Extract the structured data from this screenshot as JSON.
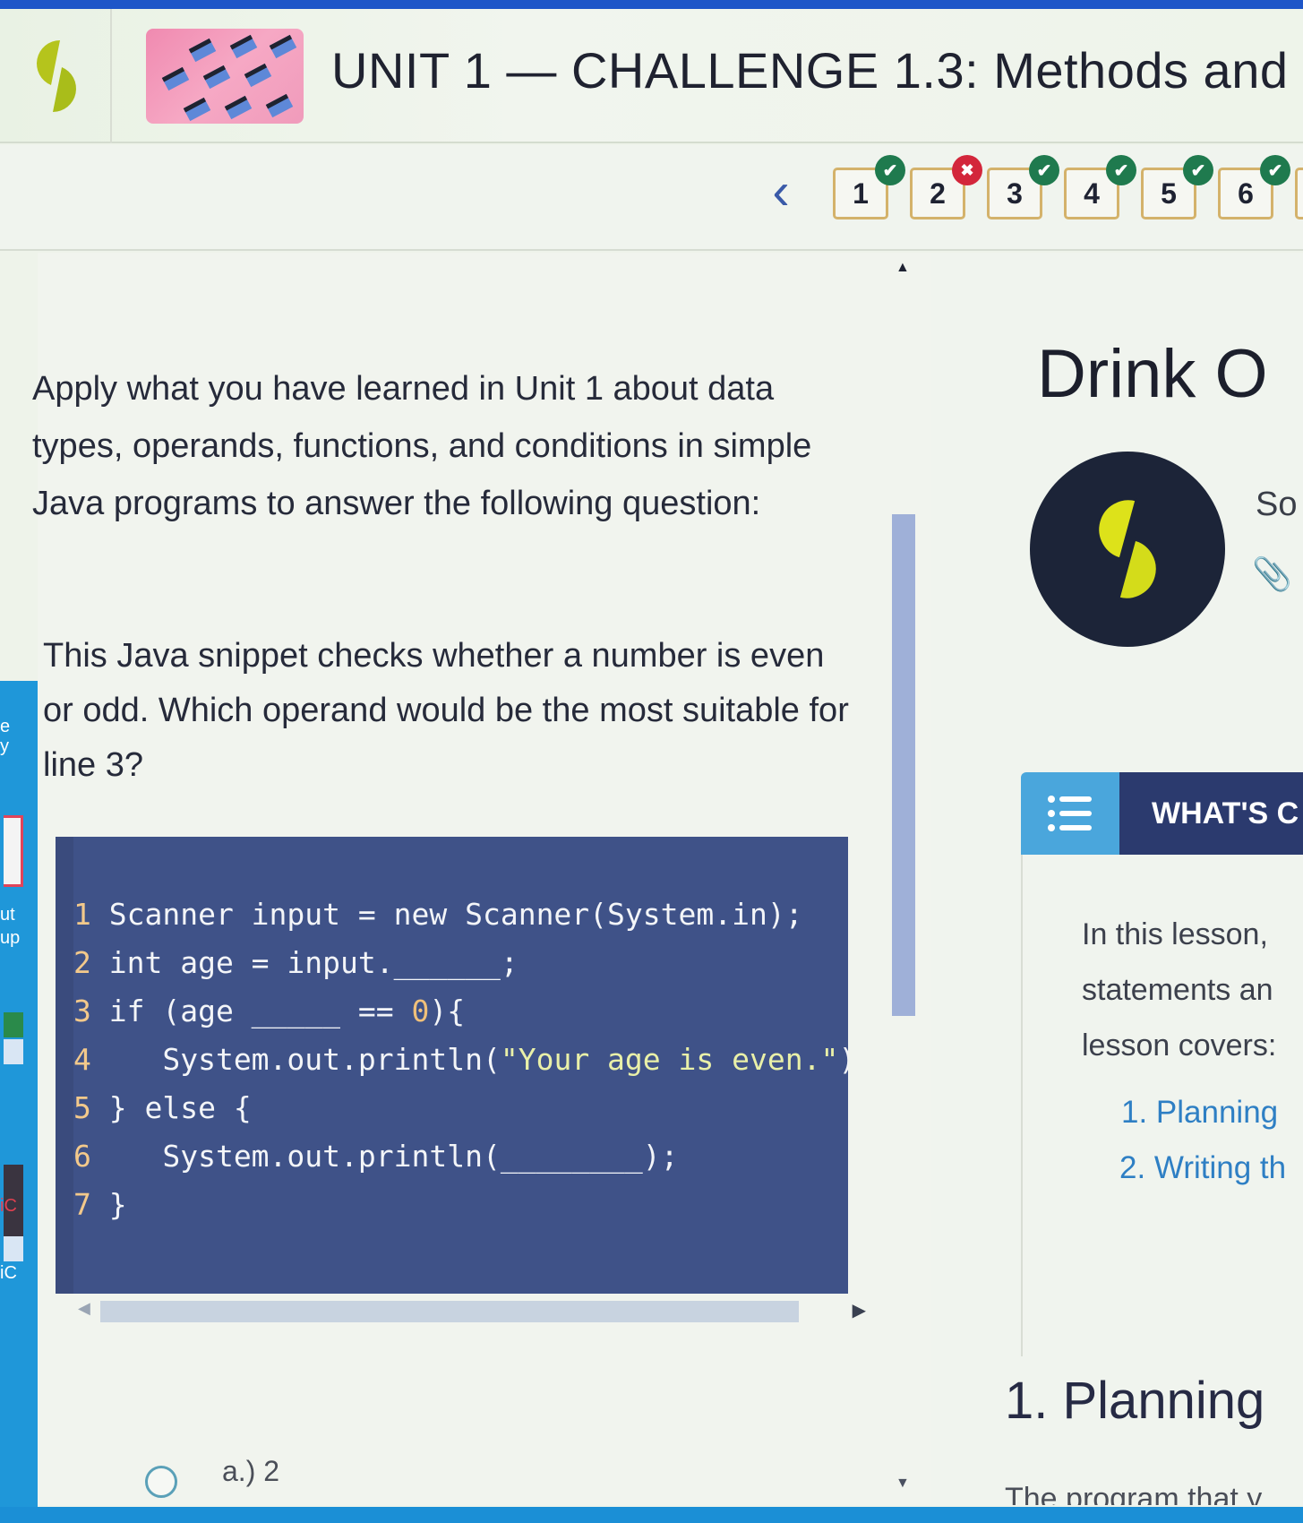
{
  "header": {
    "title": "UNIT 1 — CHALLENGE 1.3: Methods and",
    "logo_icon": "sophia-logo-icon",
    "thumbnail_icon": "graduation-caps-thumbnail"
  },
  "question_nav": {
    "prev_icon": "chevron-left-icon",
    "prev_glyph": "‹",
    "questions": [
      {
        "number": "1",
        "status": "correct",
        "badge_glyph": "✔"
      },
      {
        "number": "2",
        "status": "incorrect",
        "badge_glyph": "✖"
      },
      {
        "number": "3",
        "status": "correct",
        "badge_glyph": "✔"
      },
      {
        "number": "4",
        "status": "correct",
        "badge_glyph": "✔"
      },
      {
        "number": "5",
        "status": "correct",
        "badge_glyph": "✔"
      },
      {
        "number": "6",
        "status": "correct",
        "badge_glyph": "✔"
      }
    ],
    "colors": {
      "correct": "#1f7a4e",
      "incorrect": "#d3263b",
      "box_border": "#d4b26b"
    }
  },
  "question_panel": {
    "prompt": "Apply what you have learned in Unit 1 about data types, operands, functions, and conditions in simple Java programs to answer the following question:",
    "question": "This Java snippet checks whether a number is even or odd. Which operand would be the most suitable for line 3?",
    "code": {
      "lines": [
        {
          "n": "1",
          "pre": " Scanner input = new Scanner(System.in);",
          "str": "",
          "post": "",
          "num": ""
        },
        {
          "n": "2",
          "pre": " int age = input.______;",
          "str": "",
          "post": "",
          "num": ""
        },
        {
          "n": "3",
          "pre": " if (age _____ == ",
          "str": "",
          "num": "0",
          "post": "){"
        },
        {
          "n": "4",
          "pre": "    System.out.println(",
          "str": "\"Your age is even.\"",
          "num": "",
          "post": ");"
        },
        {
          "n": "5",
          "pre": " } else {",
          "str": "",
          "post": "",
          "num": ""
        },
        {
          "n": "6",
          "pre": "    System.out.println(________);",
          "str": "",
          "post": "",
          "num": ""
        },
        {
          "n": "7",
          "pre": " }",
          "str": "",
          "post": "",
          "num": ""
        }
      ]
    },
    "answers": [
      {
        "label": "a.) 2",
        "selected": false
      }
    ]
  },
  "tutorial_panel": {
    "title": "Drink O",
    "author_fragment": "So",
    "attachment_icon": "paperclip-icon",
    "whats_covered": {
      "icon": "list-icon",
      "title": "WHAT'S C",
      "text_lines": [
        "In this lesson,",
        "statements an",
        "lesson covers:"
      ],
      "links": [
        "1. Planning",
        "2. Writing th"
      ]
    },
    "section_heading": "1. Planning",
    "cut_text": "The program that y"
  },
  "desktop_fragments": [
    "e",
    "y",
    "ut",
    "up",
    "iC",
    "iC"
  ]
}
